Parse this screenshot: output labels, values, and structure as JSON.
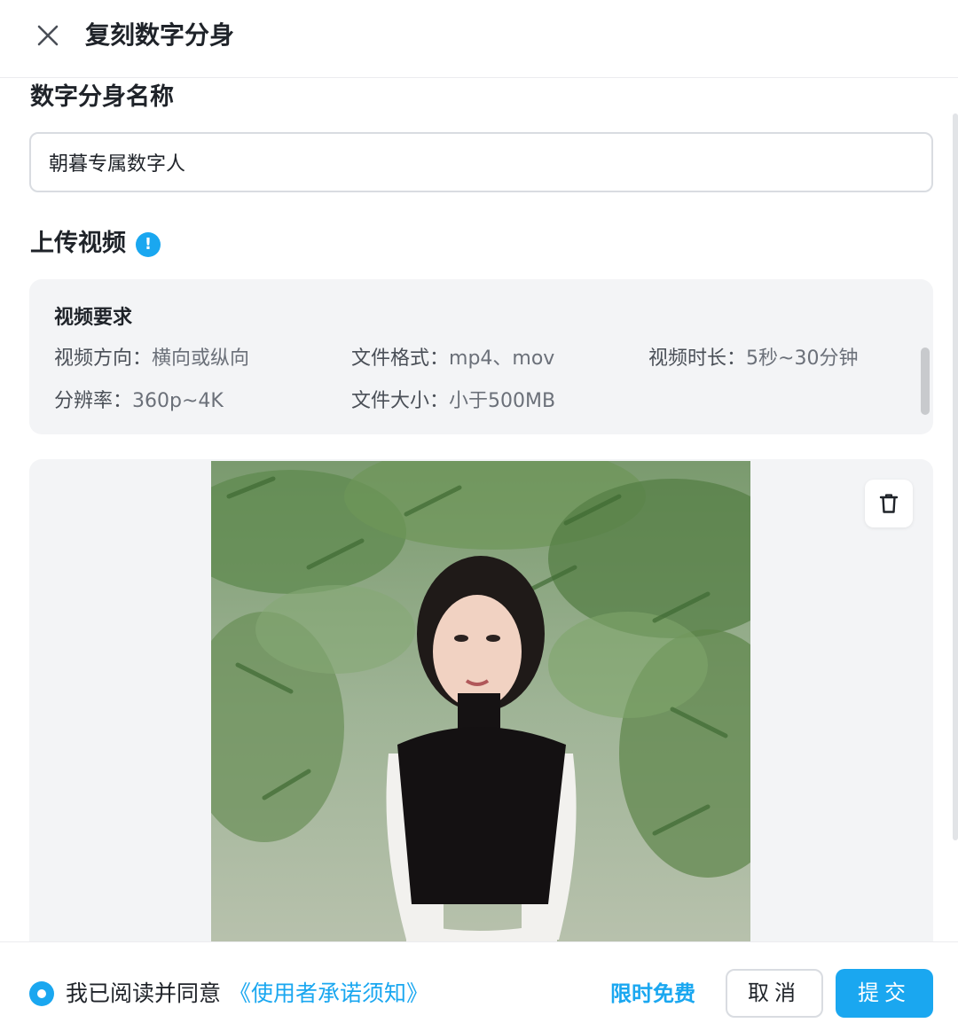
{
  "header": {
    "title": "复刻数字分身",
    "close_icon": "close-icon"
  },
  "name_section": {
    "title": "数字分身名称",
    "input_value": "朝暮专属数字人"
  },
  "upload_section": {
    "title": "上传视频",
    "info_icon": "info-icon",
    "info_glyph": "!",
    "requirements": {
      "title": "视频要求",
      "items": [
        {
          "label": "视频方向：",
          "value": "横向或纵向"
        },
        {
          "label": "文件格式：",
          "value": "mp4、mov"
        },
        {
          "label": "视频时长：",
          "value": "5秒~30分钟"
        },
        {
          "label": "分辨率：",
          "value": "360p~4K"
        },
        {
          "label": "文件大小：",
          "value": "小于500MB"
        }
      ]
    },
    "delete_icon": "trash-icon"
  },
  "footer": {
    "agree_text": "我已阅读并同意",
    "agree_link": "《使用者承诺须知》",
    "promo": "限时免费",
    "cancel_label": "取消",
    "submit_label": "提交"
  },
  "colors": {
    "accent": "#1aa7f0",
    "panel_bg": "#f3f4f6"
  }
}
